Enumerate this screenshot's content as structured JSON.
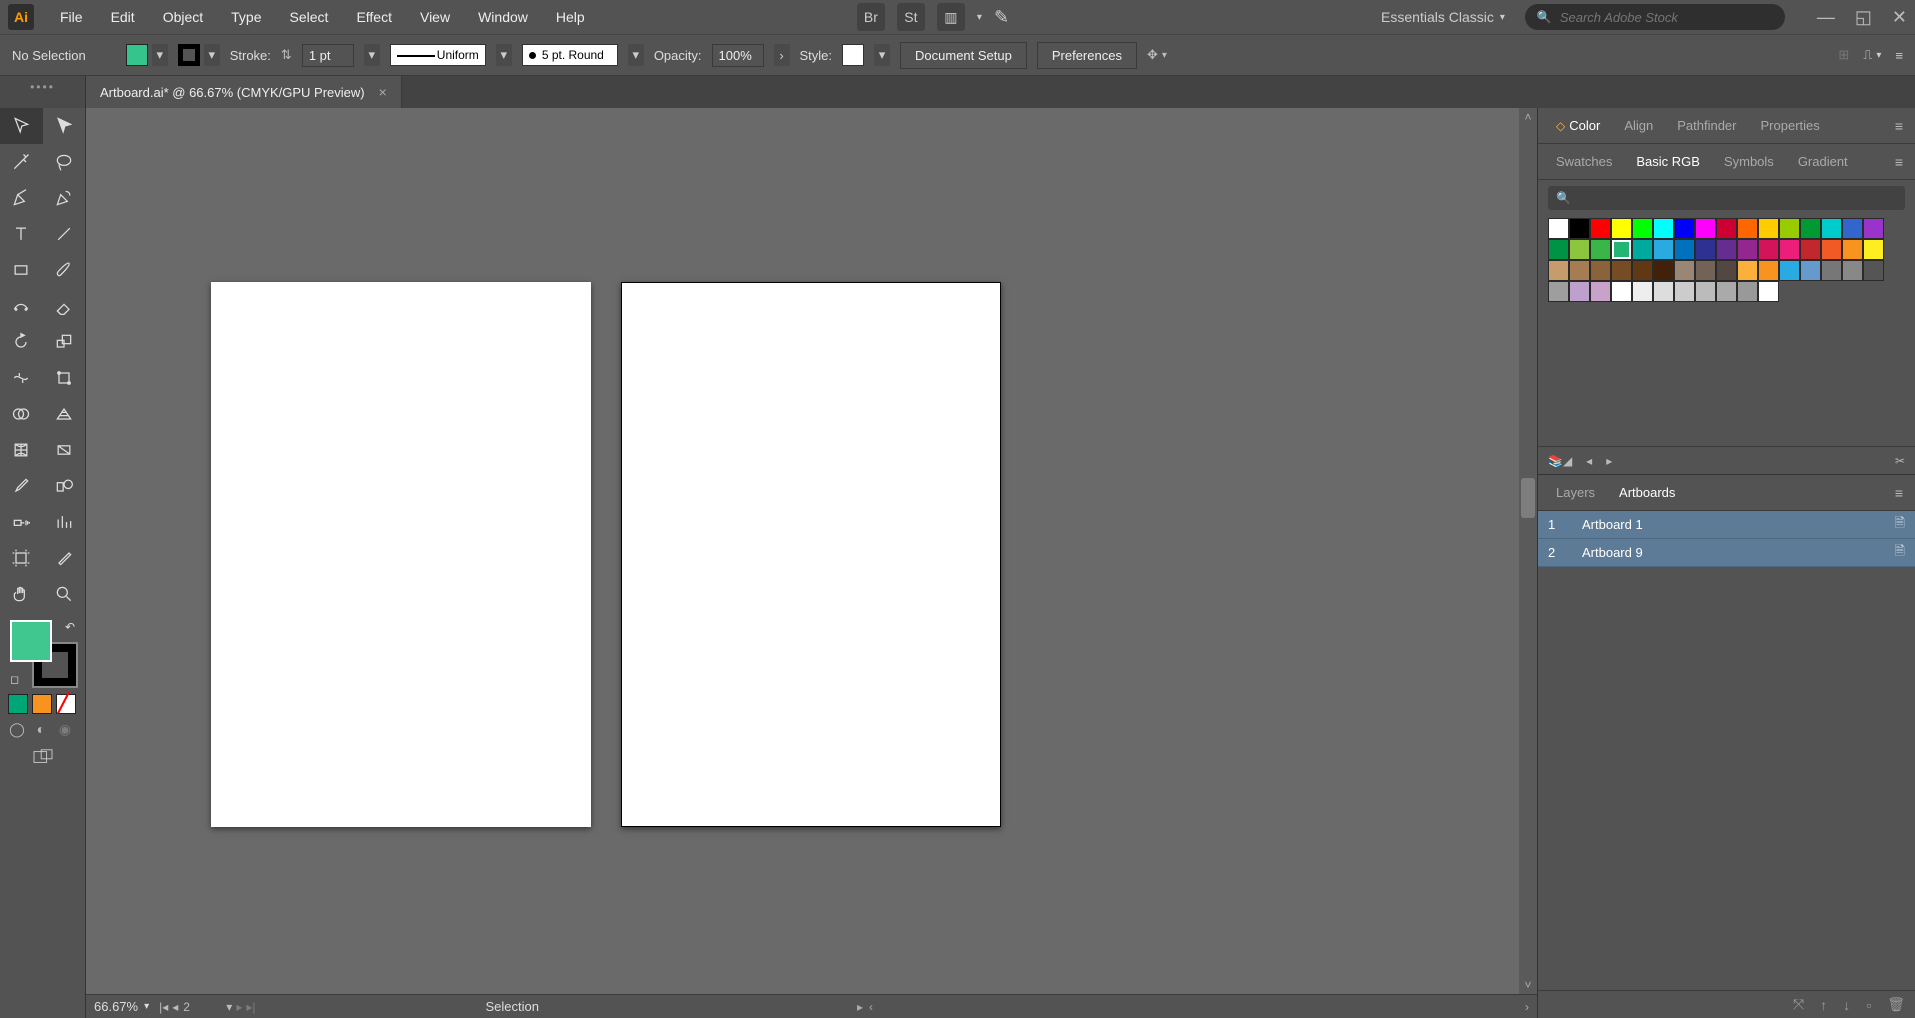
{
  "app": {
    "logo_text": "Ai"
  },
  "menu": {
    "file": "File",
    "edit": "Edit",
    "object": "Object",
    "type": "Type",
    "select": "Select",
    "effect": "Effect",
    "view": "View",
    "window": "Window",
    "help": "Help"
  },
  "top_right": {
    "br": "Br",
    "st": "St",
    "workspace": "Essentials Classic",
    "search_placeholder": "Search Adobe Stock"
  },
  "controlbar": {
    "no_selection": "No Selection",
    "fill_color": "#34c48c",
    "stroke_color": "#000000",
    "stroke_label": "Stroke:",
    "stroke_weight": "1 pt",
    "uniform_label": "Uniform",
    "profile_label": "5 pt. Round",
    "opacity_label": "Opacity:",
    "opacity_value": "100%",
    "style_label": "Style:",
    "doc_setup": "Document Setup",
    "preferences": "Preferences"
  },
  "document_tab": {
    "title": "Artboard.ai* @ 66.67% (CMYK/GPU Preview)"
  },
  "right_panels": {
    "group1": {
      "tabs": [
        "Color",
        "Align",
        "Pathfinder",
        "Properties"
      ],
      "active": "Color"
    },
    "swatches": {
      "tabs": [
        "Swatches",
        "Basic RGB",
        "Symbols",
        "Gradient"
      ],
      "active": "Basic RGB"
    },
    "swatch_colors_row1": [
      "#ffffff",
      "#000000",
      "#ff0000",
      "#ffff00",
      "#00ff00",
      "#00ffff",
      "#0000ff",
      "#ff00ff",
      "#cc0033",
      "#ff6600",
      "#ffcc00",
      "#99cc00",
      "#009933",
      "#00cccc",
      "#3366cc",
      "#9933cc"
    ],
    "swatch_colors_row2": [
      "#009245",
      "#8cc63f",
      "#39b54a",
      "#22b573",
      "#00a99d",
      "#29abe2",
      "#0071bc",
      "#2e3192",
      "#662d91",
      "#93278f",
      "#d4145a",
      "#ed1e79",
      "#c1272d",
      "#f15a24",
      "#f7931e",
      "#fcee21"
    ],
    "swatch_colors_row3": [
      "#c69c6d",
      "#a67c52",
      "#8c6239",
      "#754c24",
      "#603813",
      "#42210b",
      "#998675",
      "#736357",
      "#534741",
      "#fbb03b",
      "#f7931e",
      "#29abe2",
      "#6699cc",
      "#777777",
      "#888888",
      "#555555"
    ],
    "swatch_colors_row4": [
      "#9e9e9e",
      "#bda0cb",
      "#c8a2c8",
      "#ffffff",
      "#eeeeee",
      "#dddddd",
      "#cccccc",
      "#bbbbbb",
      "#aaaaaa",
      "#999999",
      "#ffffff"
    ],
    "swatch_selected_index": 19,
    "artboards": {
      "tabs": [
        "Layers",
        "Artboards"
      ],
      "active": "Artboards",
      "rows": [
        {
          "index": "1",
          "name": "Artboard 1"
        },
        {
          "index": "2",
          "name": "Artboard 9"
        }
      ]
    }
  },
  "statusbar": {
    "zoom": "66.67%",
    "artboard_nav": "2",
    "tool_name": "Selection"
  },
  "toolbox": {
    "fill_color": "#3fc78f",
    "stroke_color": "#000000",
    "mode_colors": [
      "#00a776",
      "#f7931e"
    ]
  }
}
